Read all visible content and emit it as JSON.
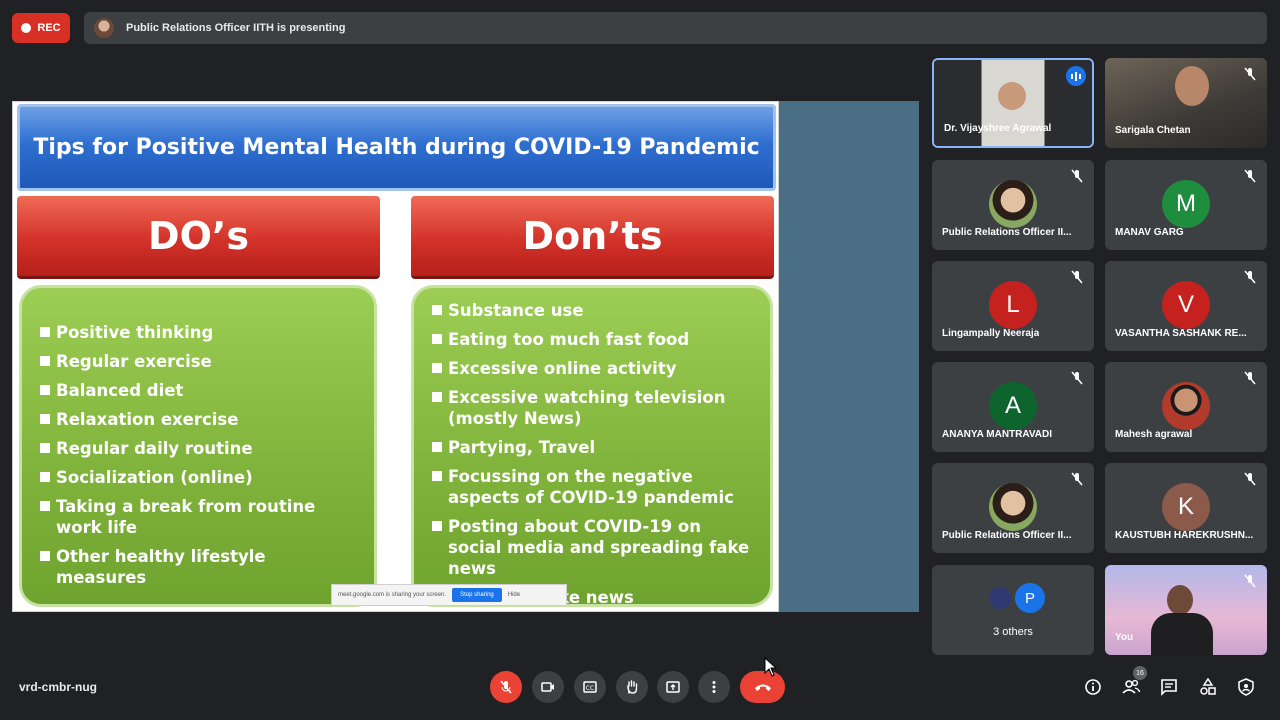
{
  "top_bar": {
    "rec_label": "REC",
    "presenting_text": "Public Relations Officer IITH is presenting"
  },
  "slide": {
    "title": "Tips for Positive Mental Health during COVID-19 Pandemic",
    "dos_heading": "DO’s",
    "donts_heading": "Don’ts",
    "dos": [
      "Positive thinking",
      "Regular exercise",
      "Balanced diet",
      "Relaxation exercise",
      "Regular daily routine",
      "Socialization (online)",
      "Taking a break from routine work life",
      "Other healthy lifestyle measures"
    ],
    "donts": [
      "Substance use",
      "Eating too much fast food",
      "Excessive online activity",
      "Excessive watching television (mostly News)",
      "Partying, Travel",
      "Focussing on the negative aspects of COVID-19 pandemic",
      "Posting about COVID-19 on social media and spreading fake news",
      "Believing fake news"
    ]
  },
  "share_banner": {
    "text": "meet.google.com is sharing your screen.",
    "stop_label": "Stop sharing",
    "hide_label": "Hide"
  },
  "participants": [
    {
      "name": "Dr. Vijayshree Agrawal"
    },
    {
      "name": "Sarigala Chetan"
    },
    {
      "name": "Public Relations Officer II..."
    },
    {
      "name": "MANAV GARG",
      "initial": "M"
    },
    {
      "name": "Lingampally Neeraja",
      "initial": "L"
    },
    {
      "name": "VASANTHA SASHANK RE...",
      "initial": "V"
    },
    {
      "name": "ANANYA MANTRAVADI",
      "initial": "A"
    },
    {
      "name": "Mahesh agrawal"
    },
    {
      "name": "Public Relations Officer II..."
    },
    {
      "name": "KAUSTUBH HAREKRUSHN...",
      "initial": "K"
    },
    {
      "name": "3 others",
      "initial": "P"
    },
    {
      "name": "You"
    }
  ],
  "colors": {
    "manav": "#1e8e3e",
    "lingampally": "#c5221f",
    "vasantha": "#c5221f",
    "ananya": "#0d652d",
    "kaustubh": "#8c5a4a",
    "others": "#1a73e8"
  },
  "bottom_bar": {
    "meeting_code": "vrd-cmbr-nug",
    "participant_count": "16"
  }
}
